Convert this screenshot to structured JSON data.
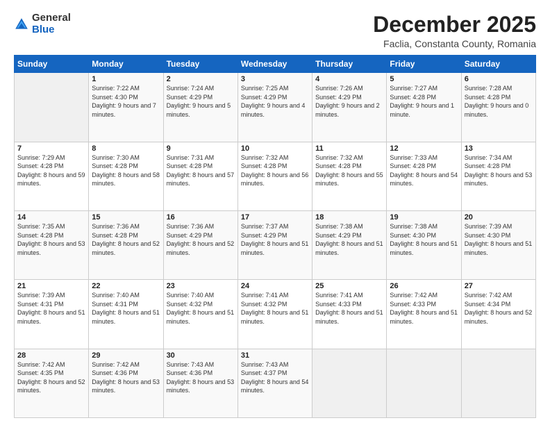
{
  "logo": {
    "general": "General",
    "blue": "Blue"
  },
  "header": {
    "month": "December 2025",
    "location": "Faclia, Constanta County, Romania"
  },
  "days_of_week": [
    "Sunday",
    "Monday",
    "Tuesday",
    "Wednesday",
    "Thursday",
    "Friday",
    "Saturday"
  ],
  "weeks": [
    [
      {
        "day": "",
        "info": ""
      },
      {
        "day": "1",
        "info": "Sunrise: 7:22 AM\nSunset: 4:30 PM\nDaylight: 9 hours\nand 7 minutes."
      },
      {
        "day": "2",
        "info": "Sunrise: 7:24 AM\nSunset: 4:29 PM\nDaylight: 9 hours\nand 5 minutes."
      },
      {
        "day": "3",
        "info": "Sunrise: 7:25 AM\nSunset: 4:29 PM\nDaylight: 9 hours\nand 4 minutes."
      },
      {
        "day": "4",
        "info": "Sunrise: 7:26 AM\nSunset: 4:29 PM\nDaylight: 9 hours\nand 2 minutes."
      },
      {
        "day": "5",
        "info": "Sunrise: 7:27 AM\nSunset: 4:28 PM\nDaylight: 9 hours\nand 1 minute."
      },
      {
        "day": "6",
        "info": "Sunrise: 7:28 AM\nSunset: 4:28 PM\nDaylight: 9 hours\nand 0 minutes."
      }
    ],
    [
      {
        "day": "7",
        "info": "Sunrise: 7:29 AM\nSunset: 4:28 PM\nDaylight: 8 hours\nand 59 minutes."
      },
      {
        "day": "8",
        "info": "Sunrise: 7:30 AM\nSunset: 4:28 PM\nDaylight: 8 hours\nand 58 minutes."
      },
      {
        "day": "9",
        "info": "Sunrise: 7:31 AM\nSunset: 4:28 PM\nDaylight: 8 hours\nand 57 minutes."
      },
      {
        "day": "10",
        "info": "Sunrise: 7:32 AM\nSunset: 4:28 PM\nDaylight: 8 hours\nand 56 minutes."
      },
      {
        "day": "11",
        "info": "Sunrise: 7:32 AM\nSunset: 4:28 PM\nDaylight: 8 hours\nand 55 minutes."
      },
      {
        "day": "12",
        "info": "Sunrise: 7:33 AM\nSunset: 4:28 PM\nDaylight: 8 hours\nand 54 minutes."
      },
      {
        "day": "13",
        "info": "Sunrise: 7:34 AM\nSunset: 4:28 PM\nDaylight: 8 hours\nand 53 minutes."
      }
    ],
    [
      {
        "day": "14",
        "info": "Sunrise: 7:35 AM\nSunset: 4:28 PM\nDaylight: 8 hours\nand 53 minutes."
      },
      {
        "day": "15",
        "info": "Sunrise: 7:36 AM\nSunset: 4:28 PM\nDaylight: 8 hours\nand 52 minutes."
      },
      {
        "day": "16",
        "info": "Sunrise: 7:36 AM\nSunset: 4:29 PM\nDaylight: 8 hours\nand 52 minutes."
      },
      {
        "day": "17",
        "info": "Sunrise: 7:37 AM\nSunset: 4:29 PM\nDaylight: 8 hours\nand 51 minutes."
      },
      {
        "day": "18",
        "info": "Sunrise: 7:38 AM\nSunset: 4:29 PM\nDaylight: 8 hours\nand 51 minutes."
      },
      {
        "day": "19",
        "info": "Sunrise: 7:38 AM\nSunset: 4:30 PM\nDaylight: 8 hours\nand 51 minutes."
      },
      {
        "day": "20",
        "info": "Sunrise: 7:39 AM\nSunset: 4:30 PM\nDaylight: 8 hours\nand 51 minutes."
      }
    ],
    [
      {
        "day": "21",
        "info": "Sunrise: 7:39 AM\nSunset: 4:31 PM\nDaylight: 8 hours\nand 51 minutes."
      },
      {
        "day": "22",
        "info": "Sunrise: 7:40 AM\nSunset: 4:31 PM\nDaylight: 8 hours\nand 51 minutes."
      },
      {
        "day": "23",
        "info": "Sunrise: 7:40 AM\nSunset: 4:32 PM\nDaylight: 8 hours\nand 51 minutes."
      },
      {
        "day": "24",
        "info": "Sunrise: 7:41 AM\nSunset: 4:32 PM\nDaylight: 8 hours\nand 51 minutes."
      },
      {
        "day": "25",
        "info": "Sunrise: 7:41 AM\nSunset: 4:33 PM\nDaylight: 8 hours\nand 51 minutes."
      },
      {
        "day": "26",
        "info": "Sunrise: 7:42 AM\nSunset: 4:33 PM\nDaylight: 8 hours\nand 51 minutes."
      },
      {
        "day": "27",
        "info": "Sunrise: 7:42 AM\nSunset: 4:34 PM\nDaylight: 8 hours\nand 52 minutes."
      }
    ],
    [
      {
        "day": "28",
        "info": "Sunrise: 7:42 AM\nSunset: 4:35 PM\nDaylight: 8 hours\nand 52 minutes."
      },
      {
        "day": "29",
        "info": "Sunrise: 7:42 AM\nSunset: 4:36 PM\nDaylight: 8 hours\nand 53 minutes."
      },
      {
        "day": "30",
        "info": "Sunrise: 7:43 AM\nSunset: 4:36 PM\nDaylight: 8 hours\nand 53 minutes."
      },
      {
        "day": "31",
        "info": "Sunrise: 7:43 AM\nSunset: 4:37 PM\nDaylight: 8 hours\nand 54 minutes."
      },
      {
        "day": "",
        "info": ""
      },
      {
        "day": "",
        "info": ""
      },
      {
        "day": "",
        "info": ""
      }
    ]
  ]
}
